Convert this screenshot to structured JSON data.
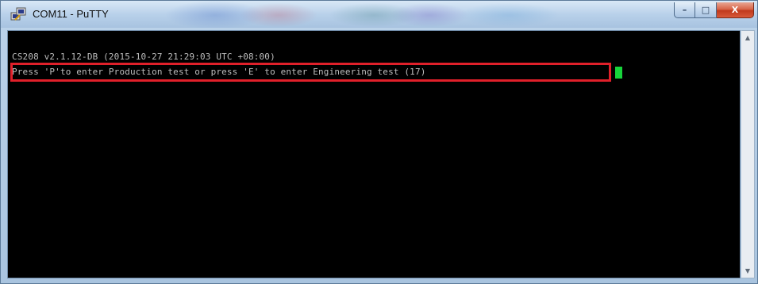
{
  "window": {
    "title": "COM11 - PuTTY",
    "icon": "putty-icon"
  },
  "captions": {
    "minimize_glyph": "–",
    "maximize_glyph": "□",
    "close_glyph": "X"
  },
  "terminal": {
    "lines": [
      "CS208 v2.1.12-DB (2015-10-27 21:29:03 UTC +08:00)",
      "Press 'P'to enter Production test or press 'E' to enter Engineering test (17)"
    ],
    "background_color": "#000000",
    "text_color": "#bfbfbf",
    "cursor_color": "#17d43b",
    "highlight_color": "#e0202a"
  },
  "scrollbar": {
    "up_glyph": "▲",
    "down_glyph": "▼"
  }
}
